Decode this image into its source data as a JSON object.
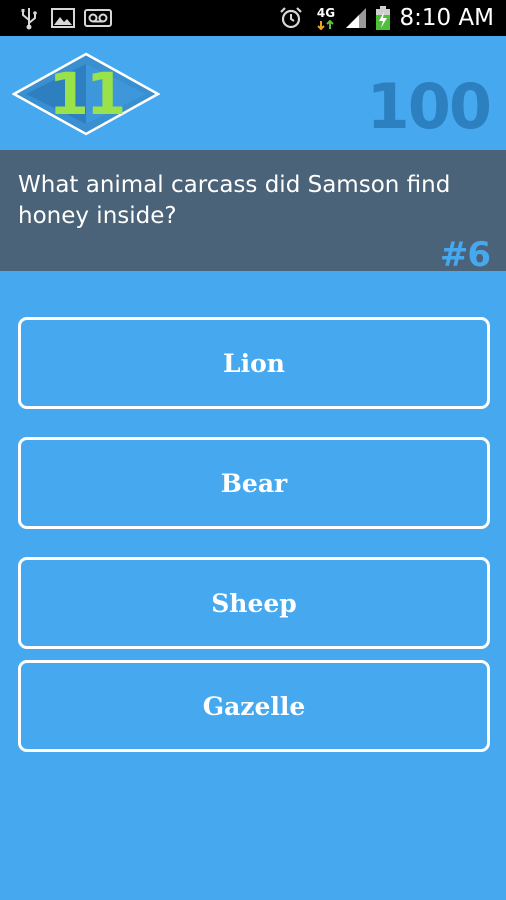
{
  "status_bar": {
    "time": "8:10 AM",
    "network_label": "4G",
    "icons": [
      "usb-icon",
      "image-icon",
      "voicemail-icon",
      "alarm-icon",
      "4g-icon",
      "signal-icon",
      "battery-charging-icon"
    ]
  },
  "header": {
    "level": "11",
    "score": "100"
  },
  "question": {
    "text": "What animal carcass did Samson find honey inside?",
    "number": "#6"
  },
  "answers": [
    {
      "label": "Lion"
    },
    {
      "label": "Bear"
    },
    {
      "label": "Sheep"
    },
    {
      "label": "Gazelle"
    }
  ],
  "colors": {
    "background": "#46a8ee",
    "question_panel": "#4b6378",
    "level_number": "#9ae24a",
    "score": "#2c80bf",
    "answer_border": "#ffffff"
  }
}
